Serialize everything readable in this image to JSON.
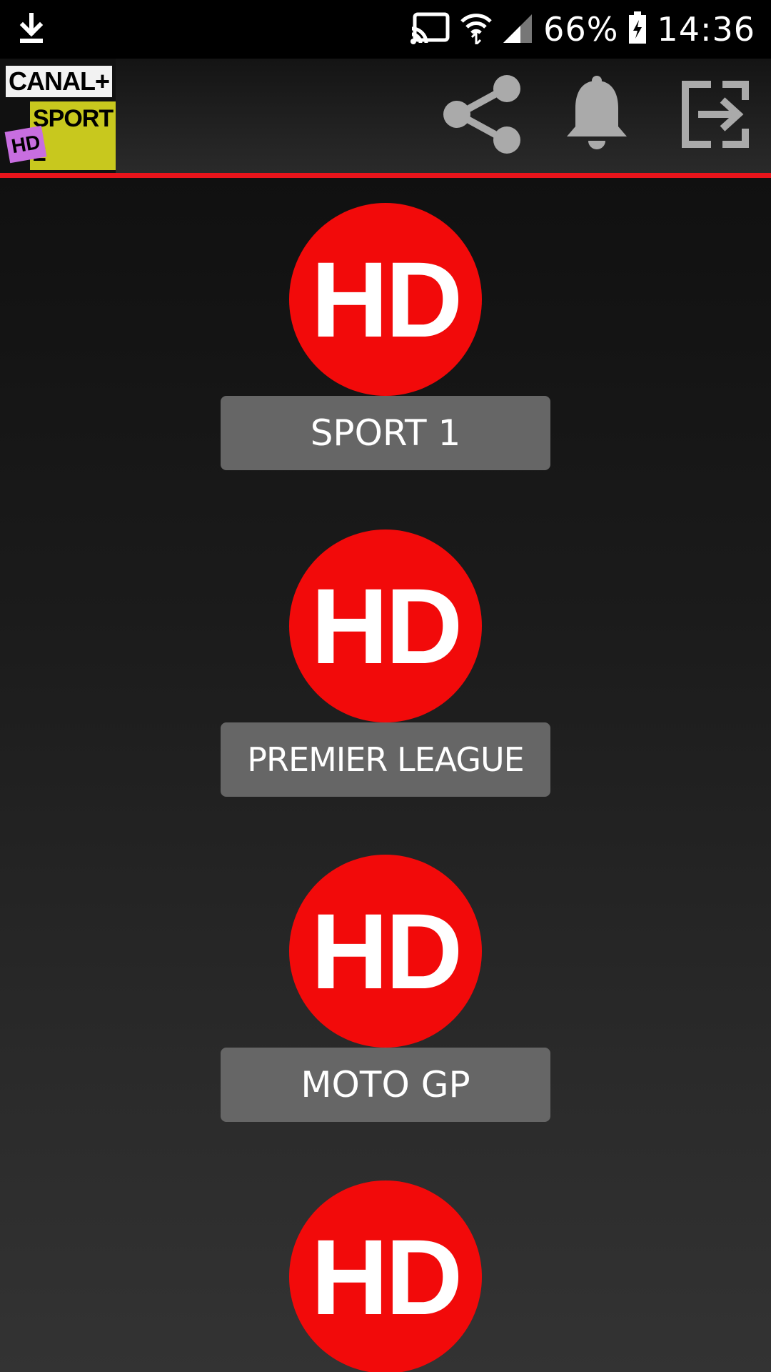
{
  "status_bar": {
    "battery": "66%",
    "time": "14:36",
    "icons": [
      "download-icon",
      "cast-icon",
      "wifi-icon",
      "signal-icon",
      "battery-charging-icon"
    ]
  },
  "app_bar": {
    "logo": {
      "line1": "CANAL+",
      "line2": "SPORT 2",
      "line3": "HD"
    },
    "actions": [
      "share-icon",
      "bell-icon",
      "exit-icon"
    ],
    "accent_color": "#e8141b"
  },
  "channels": [
    {
      "badge": "HD",
      "label": "SPORT 1"
    },
    {
      "badge": "HD",
      "label": "PREMIER LEAGUE"
    },
    {
      "badge": "HD",
      "label": "MOTO GP"
    },
    {
      "badge": "HD",
      "label": ""
    }
  ],
  "colors": {
    "badge_red": "#f20a0a",
    "label_bg": "#666666",
    "text": "#ffffff"
  }
}
